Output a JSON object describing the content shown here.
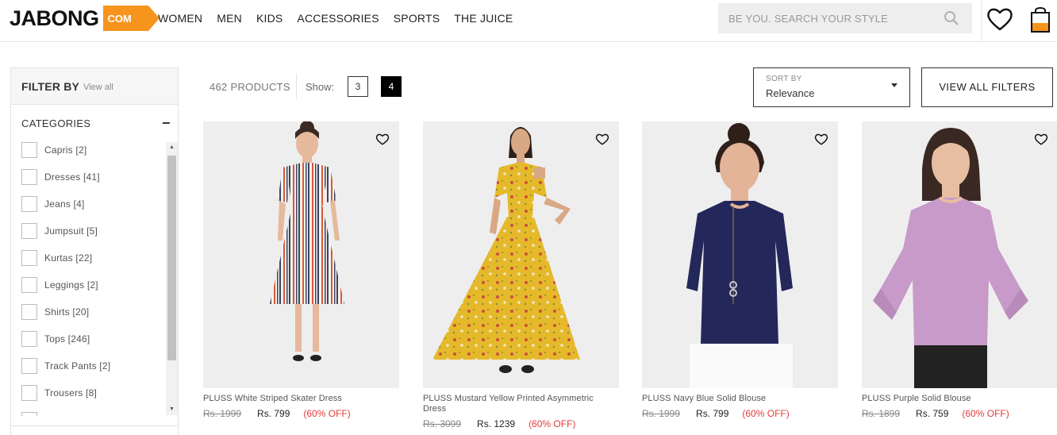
{
  "header": {
    "logo_text": "JABONG",
    "logo_tag": "COM",
    "nav": [
      "WOMEN",
      "MEN",
      "KIDS",
      "ACCESSORIES",
      "SPORTS",
      "THE JUICE"
    ],
    "search_placeholder": "BE YOU. SEARCH YOUR STYLE",
    "icons": {
      "search": "search-icon",
      "wishlist": "heart-icon",
      "bag": "shopping-bag-icon"
    },
    "accent_color": "#f7941d"
  },
  "sidebar": {
    "title": "FILTER BY",
    "view_all": "View all",
    "categories_title": "CATEGORIES",
    "collapse_symbol": "−",
    "categories": [
      "Capris [2]",
      "Dresses [41]",
      "Jeans [4]",
      "Jumpsuit [5]",
      "Kurtas [22]",
      "Leggings [2]",
      "Shirts [20]",
      "Tops [246]",
      "Track Pants [2]",
      "Trousers [8]"
    ]
  },
  "toolbar": {
    "product_count": "462 PRODUCTS",
    "show_label": "Show:",
    "grid_options": [
      "3",
      "4"
    ],
    "grid_selected": "4",
    "sort_label": "SORT BY",
    "sort_value": "Relevance",
    "view_all_filters": "VIEW ALL FILTERS"
  },
  "products": [
    {
      "name": "PLUSS White Striped Skater Dress",
      "mrp": "Rs. 1999",
      "price": "Rs. 799",
      "discount": "(60% OFF)"
    },
    {
      "name": "PLUSS Mustard Yellow Printed Asymmetric Dress",
      "mrp": "Rs. 3099",
      "price": "Rs. 1239",
      "discount": "(60% OFF)"
    },
    {
      "name": "PLUSS Navy Blue Solid Blouse",
      "mrp": "Rs. 1999",
      "price": "Rs. 799",
      "discount": "(60% OFF)"
    },
    {
      "name": "PLUSS Purple Solid Blouse",
      "mrp": "Rs. 1899",
      "price": "Rs. 759",
      "discount": "(60% OFF)"
    }
  ]
}
